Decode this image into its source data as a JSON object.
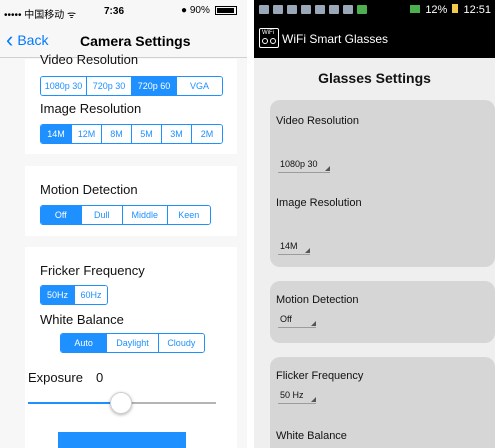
{
  "ios": {
    "status": {
      "carrier": "••••• 中国移动 ᯤ",
      "time": "7:36",
      "battery": "● 90%"
    },
    "nav": {
      "back_label": "Back",
      "title": "Camera Settings"
    },
    "video_resolution": {
      "label": "Video Resolution",
      "options": [
        "1080p 30",
        "720p 30",
        "720p 60",
        "VGA"
      ],
      "selected": "720p 60"
    },
    "image_resolution": {
      "label": "Image Resolution",
      "options": [
        "14M",
        "12M",
        "8M",
        "5M",
        "3M",
        "2M"
      ],
      "selected": "14M"
    },
    "motion_detection": {
      "label": "Motion Detection",
      "options": [
        "Off",
        "Dull",
        "Middle",
        "Keen"
      ],
      "selected": "Off"
    },
    "flicker_frequency": {
      "label": "Fricker Frequency",
      "options": [
        "50Hz",
        "60Hz"
      ],
      "selected": "50Hz"
    },
    "white_balance": {
      "label": "White Balance",
      "options": [
        "Auto",
        "Daylight",
        "Cloudy"
      ],
      "selected": "Auto"
    },
    "exposure": {
      "label": "Exposure",
      "value": "0",
      "slider_fraction": 0.5
    }
  },
  "android": {
    "status": {
      "time": "12:51",
      "battery": "12%"
    },
    "app_title": "WiFi Smart Glasses",
    "logo_text": "WiFi",
    "page_title": "Glasses Settings",
    "video_resolution": {
      "label": "Video Resolution",
      "value": "1080p 30"
    },
    "image_resolution": {
      "label": "Image Resolution",
      "value": "14M"
    },
    "motion_detection": {
      "label": "Motion Detection",
      "value": "Off"
    },
    "flicker_frequency": {
      "label": "Flicker Frequency",
      "value": "50 Hz"
    },
    "white_balance": {
      "label": "White Balance"
    }
  },
  "colors": {
    "ios_accent": "#1e90ff",
    "android_card": "#d6d6d6"
  }
}
